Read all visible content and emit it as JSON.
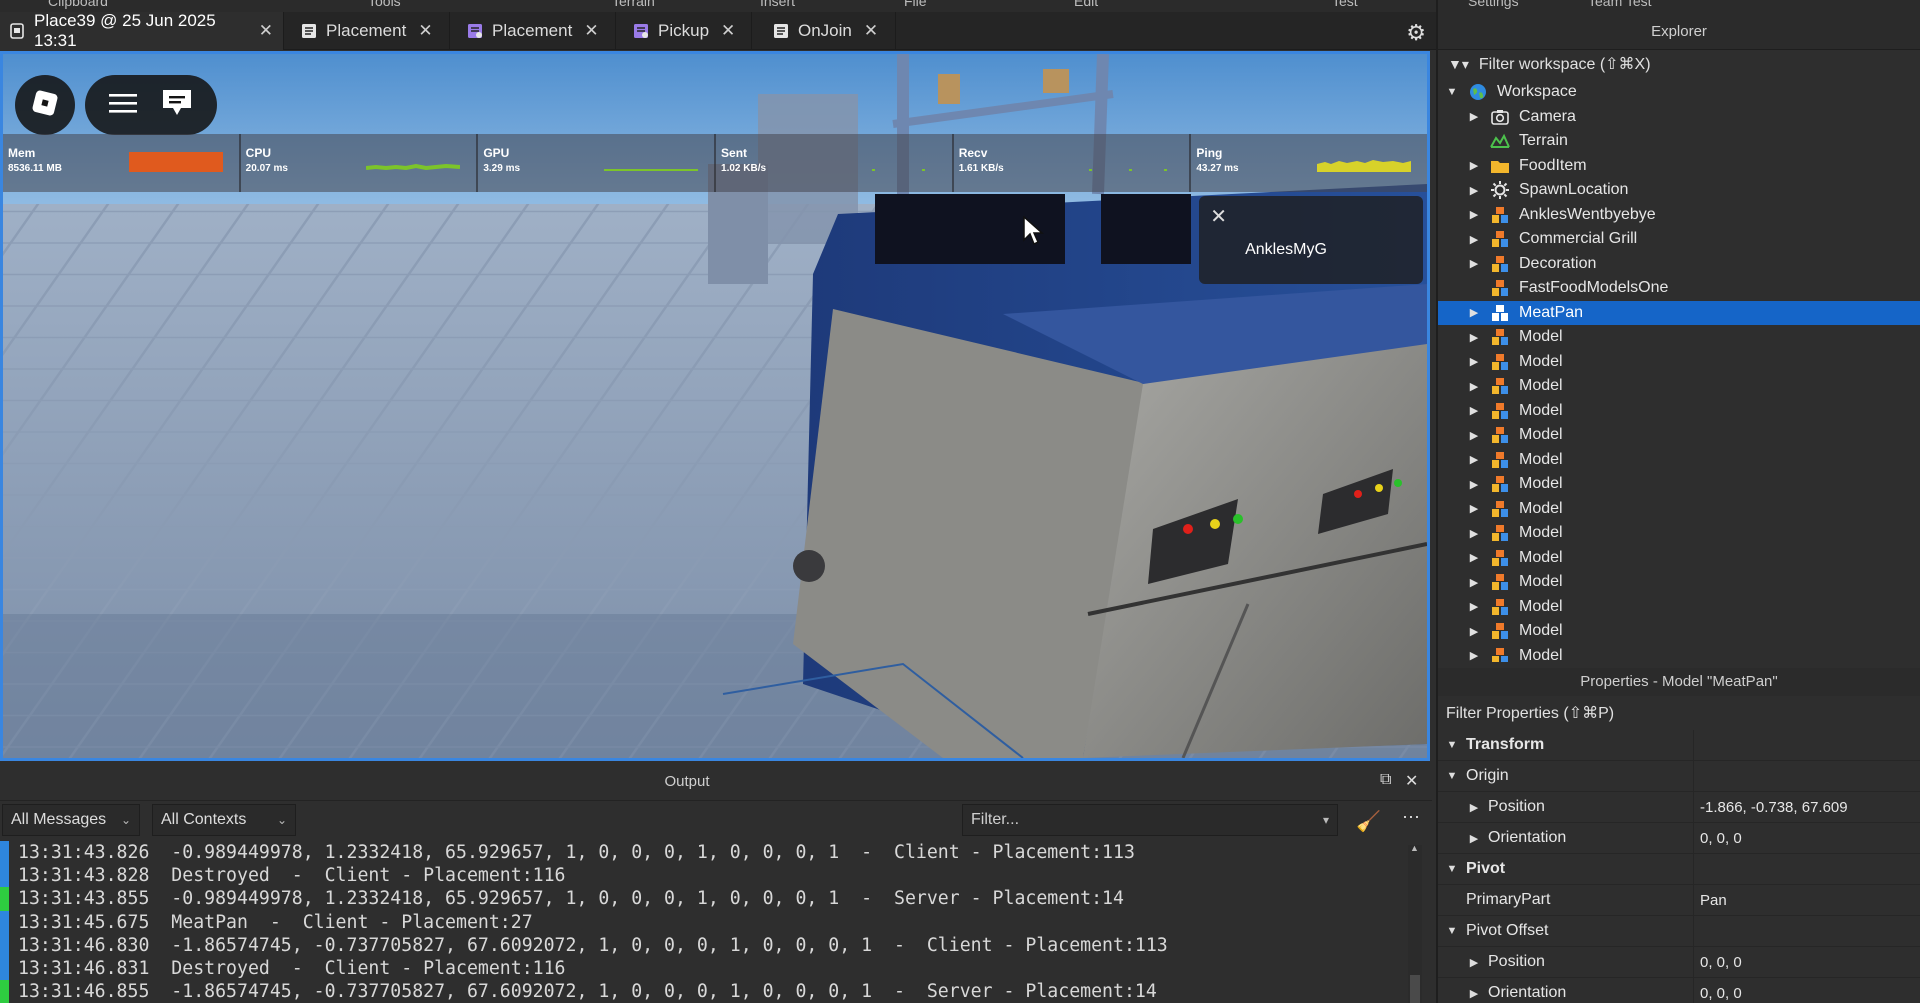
{
  "ribbon": [
    "Clipboard",
    "Tools",
    "Terrain",
    "Insert",
    "File",
    "Edit",
    "Test",
    "Settings",
    "Team Test"
  ],
  "tabs": [
    {
      "label": "Place39 @ 25 Jun 2025 13:31",
      "icon": "place-icon"
    },
    {
      "label": "Placement",
      "icon": "script-icon"
    },
    {
      "label": "Placement",
      "icon": "local-script-icon"
    },
    {
      "label": "Pickup",
      "icon": "local-script-icon"
    },
    {
      "label": "OnJoin",
      "icon": "script-icon"
    }
  ],
  "viewport": {
    "stats": [
      {
        "label": "Mem",
        "value": "8536.11 MB",
        "color": "#e05a1e"
      },
      {
        "label": "CPU",
        "value": "20.07 ms",
        "color": "#7cc42a"
      },
      {
        "label": "GPU",
        "value": "3.29 ms",
        "color": "#7cc42a"
      },
      {
        "label": "Sent",
        "value": "1.02 KB/s",
        "color": "#7cc42a"
      },
      {
        "label": "Recv",
        "value": "1.61 KB/s",
        "color": "#7cc42a"
      },
      {
        "label": "Ping",
        "value": "43.27 ms",
        "color": "#d7d22a"
      }
    ],
    "tooltip_name": "AnklesMyG"
  },
  "output": {
    "title": "Output",
    "messages_filter": "All Messages",
    "contexts_filter": "All Contexts",
    "filter_placeholder": "Filter...",
    "lines": [
      {
        "time": "13:31:43.826",
        "text": "-0.989449978, 1.2332418, 65.929657, 1, 0, 0, 0, 1, 0, 0, 0, 1  -  Client - Placement:113",
        "mark": "#2e86de"
      },
      {
        "time": "13:31:43.828",
        "text": "Destroyed  -  Client - Placement:116",
        "mark": "#2e86de"
      },
      {
        "time": "13:31:43.855",
        "text": "-0.989449978, 1.2332418, 65.929657, 1, 0, 0, 0, 1, 0, 0, 0, 1  -  Server - Placement:14",
        "mark": "#2ecc40"
      },
      {
        "time": "13:31:45.675",
        "text": "MeatPan  -  Client - Placement:27",
        "mark": "#2e86de"
      },
      {
        "time": "13:31:46.830",
        "text": "-1.86574745, -0.737705827, 67.6092072, 1, 0, 0, 0, 1, 0, 0, 0, 1  -  Client - Placement:113",
        "mark": "#2e86de"
      },
      {
        "time": "13:31:46.831",
        "text": "Destroyed  -  Client - Placement:116",
        "mark": "#2e86de"
      },
      {
        "time": "13:31:46.855",
        "text": "-1.86574745, -0.737705827, 67.6092072, 1, 0, 0, 0, 1, 0, 0, 0, 1  -  Server - Placement:14",
        "mark": "#2ecc40"
      }
    ]
  },
  "explorer": {
    "title": "Explorer",
    "filter": "Filter workspace (⇧⌘X)",
    "nodes": [
      {
        "label": "Workspace",
        "icon": "globe-icon",
        "depth": 0,
        "arrow": "expanded",
        "selected": false
      },
      {
        "label": "Camera",
        "icon": "camera-icon",
        "depth": 1,
        "arrow": "collapsed",
        "selected": false
      },
      {
        "label": "Terrain",
        "icon": "terrain-icon",
        "depth": 1,
        "arrow": "none",
        "selected": false
      },
      {
        "label": "FoodItem",
        "icon": "folder-icon",
        "depth": 1,
        "arrow": "collapsed",
        "selected": false
      },
      {
        "label": "SpawnLocation",
        "icon": "spawn-icon",
        "depth": 1,
        "arrow": "collapsed",
        "selected": false
      },
      {
        "label": "AnklesWentbyebye",
        "icon": "model-icon",
        "depth": 1,
        "arrow": "collapsed",
        "selected": false
      },
      {
        "label": "Commercial Grill",
        "icon": "model-icon",
        "depth": 1,
        "arrow": "collapsed",
        "selected": false
      },
      {
        "label": "Decoration",
        "icon": "model-icon",
        "depth": 1,
        "arrow": "collapsed",
        "selected": false
      },
      {
        "label": "FastFoodModelsOne",
        "icon": "model-icon",
        "depth": 1,
        "arrow": "none",
        "selected": false
      },
      {
        "label": "MeatPan",
        "icon": "model-icon",
        "depth": 1,
        "arrow": "collapsed",
        "selected": true
      },
      {
        "label": "Model",
        "icon": "model-icon",
        "depth": 1,
        "arrow": "collapsed",
        "selected": false
      },
      {
        "label": "Model",
        "icon": "model-icon",
        "depth": 1,
        "arrow": "collapsed",
        "selected": false
      },
      {
        "label": "Model",
        "icon": "model-icon",
        "depth": 1,
        "arrow": "collapsed",
        "selected": false
      },
      {
        "label": "Model",
        "icon": "model-icon",
        "depth": 1,
        "arrow": "collapsed",
        "selected": false
      },
      {
        "label": "Model",
        "icon": "model-icon",
        "depth": 1,
        "arrow": "collapsed",
        "selected": false
      },
      {
        "label": "Model",
        "icon": "model-icon",
        "depth": 1,
        "arrow": "collapsed",
        "selected": false
      },
      {
        "label": "Model",
        "icon": "model-icon",
        "depth": 1,
        "arrow": "collapsed",
        "selected": false
      },
      {
        "label": "Model",
        "icon": "model-icon",
        "depth": 1,
        "arrow": "collapsed",
        "selected": false
      },
      {
        "label": "Model",
        "icon": "model-icon",
        "depth": 1,
        "arrow": "collapsed",
        "selected": false
      },
      {
        "label": "Model",
        "icon": "model-icon",
        "depth": 1,
        "arrow": "collapsed",
        "selected": false
      },
      {
        "label": "Model",
        "icon": "model-icon",
        "depth": 1,
        "arrow": "collapsed",
        "selected": false
      },
      {
        "label": "Model",
        "icon": "model-icon",
        "depth": 1,
        "arrow": "collapsed",
        "selected": false
      },
      {
        "label": "Model",
        "icon": "model-icon",
        "depth": 1,
        "arrow": "collapsed",
        "selected": false
      },
      {
        "label": "Model",
        "icon": "model-icon",
        "depth": 1,
        "arrow": "collapsed",
        "selected": false
      }
    ]
  },
  "properties": {
    "title": "Properties - Model \"MeatPan\"",
    "filter": "Filter Properties (⇧⌘P)",
    "rows": [
      {
        "name": "Transform",
        "value": "",
        "kind": "group",
        "depth": 0,
        "arrow": "expanded"
      },
      {
        "name": "Origin",
        "value": "",
        "kind": "item",
        "depth": 0,
        "arrow": "expanded"
      },
      {
        "name": "Position",
        "value": "-1.866, -0.738, 67.609",
        "kind": "item",
        "depth": 1,
        "arrow": "collapsed"
      },
      {
        "name": "Orientation",
        "value": "0, 0, 0",
        "kind": "item",
        "depth": 1,
        "arrow": "collapsed"
      },
      {
        "name": "Pivot",
        "value": "",
        "kind": "group",
        "depth": 0,
        "arrow": "expanded"
      },
      {
        "name": "PrimaryPart",
        "value": "Pan",
        "kind": "item",
        "depth": 0,
        "arrow": "none"
      },
      {
        "name": "Pivot Offset",
        "value": "",
        "kind": "item",
        "depth": 0,
        "arrow": "expanded"
      },
      {
        "name": "Position",
        "value": "0, 0, 0",
        "kind": "item",
        "depth": 1,
        "arrow": "collapsed"
      },
      {
        "name": "Orientation",
        "value": "0, 0, 0",
        "kind": "item",
        "depth": 1,
        "arrow": "collapsed"
      }
    ]
  }
}
